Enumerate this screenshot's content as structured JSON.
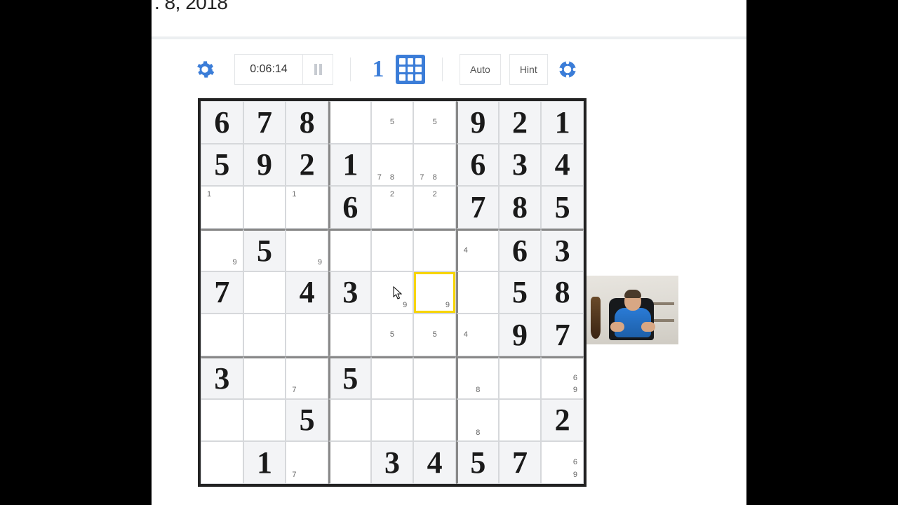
{
  "video": {
    "title_fragment": ". 8, 2018"
  },
  "toolbar": {
    "timer": "0:06:14",
    "mode_number": "1",
    "auto_label": "Auto",
    "hint_label": "Hint"
  },
  "board": {
    "selected": [
      4,
      5
    ],
    "cells": [
      [
        {
          "v": "6",
          "g": true
        },
        {
          "v": "7",
          "g": true
        },
        {
          "v": "8",
          "g": true
        },
        {
          "c": []
        },
        {
          "c": [
            5
          ]
        },
        {
          "c": [
            5
          ]
        },
        {
          "v": "9",
          "g": true
        },
        {
          "v": "2",
          "g": true
        },
        {
          "v": "1",
          "g": true
        }
      ],
      [
        {
          "v": "5",
          "g": true
        },
        {
          "v": "9",
          "g": true
        },
        {
          "v": "2",
          "g": true
        },
        {
          "v": "1",
          "g": true
        },
        {
          "c": [
            7,
            8
          ]
        },
        {
          "c": [
            7,
            8
          ]
        },
        {
          "v": "6",
          "g": true
        },
        {
          "v": "3",
          "g": true
        },
        {
          "v": "4",
          "g": true
        }
      ],
      [
        {
          "c": [
            1
          ]
        },
        {
          "c": []
        },
        {
          "c": [
            1
          ]
        },
        {
          "v": "6",
          "g": true
        },
        {
          "c": [
            2
          ]
        },
        {
          "c": [
            2
          ]
        },
        {
          "v": "7",
          "g": true
        },
        {
          "v": "8",
          "g": true
        },
        {
          "v": "5",
          "g": true
        }
      ],
      [
        {
          "c": [
            9
          ]
        },
        {
          "v": "5",
          "g": true
        },
        {
          "c": [
            9
          ]
        },
        {
          "c": []
        },
        {
          "c": []
        },
        {
          "c": []
        },
        {
          "c": [
            4
          ]
        },
        {
          "v": "6",
          "g": true
        },
        {
          "v": "3",
          "g": true
        }
      ],
      [
        {
          "v": "7",
          "g": true
        },
        {
          "c": []
        },
        {
          "v": "4",
          "g": true
        },
        {
          "v": "3",
          "g": true
        },
        {
          "c": [
            9
          ]
        },
        {
          "c": [
            9
          ]
        },
        {
          "c": []
        },
        {
          "v": "5",
          "g": true
        },
        {
          "v": "8",
          "g": true
        }
      ],
      [
        {
          "c": []
        },
        {
          "c": []
        },
        {
          "c": []
        },
        {
          "c": []
        },
        {
          "c": [
            5
          ]
        },
        {
          "c": [
            5
          ]
        },
        {
          "c": [
            4
          ]
        },
        {
          "v": "9",
          "g": true
        },
        {
          "v": "7",
          "g": true
        }
      ],
      [
        {
          "v": "3",
          "g": true
        },
        {
          "c": []
        },
        {
          "c": [
            7
          ]
        },
        {
          "v": "5",
          "g": true
        },
        {
          "c": []
        },
        {
          "c": []
        },
        {
          "c": [
            8
          ]
        },
        {
          "c": []
        },
        {
          "c": [
            6,
            9
          ]
        }
      ],
      [
        {
          "c": []
        },
        {
          "c": []
        },
        {
          "v": "5",
          "g": true
        },
        {
          "c": []
        },
        {
          "c": []
        },
        {
          "c": []
        },
        {
          "c": [
            8
          ]
        },
        {
          "c": []
        },
        {
          "v": "2",
          "g": true
        }
      ],
      [
        {
          "c": []
        },
        {
          "v": "1",
          "g": true
        },
        {
          "c": [
            7
          ]
        },
        {
          "c": []
        },
        {
          "v": "3",
          "g": true
        },
        {
          "v": "4",
          "g": true
        },
        {
          "v": "5",
          "g": true
        },
        {
          "v": "7",
          "g": true
        },
        {
          "c": [
            6,
            9
          ]
        }
      ]
    ]
  }
}
